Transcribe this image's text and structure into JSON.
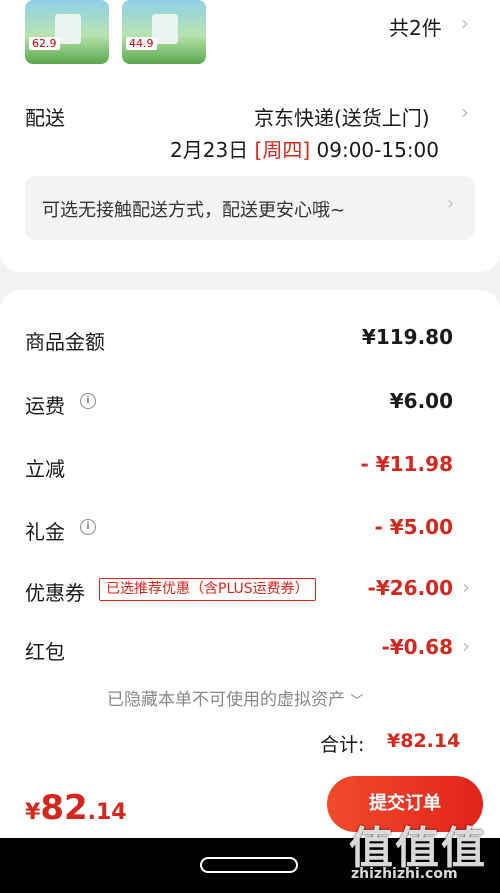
{
  "order": {
    "items_count_label": "共2件",
    "product_thumbs": [
      {
        "price": "62.9"
      },
      {
        "price": "44.9"
      }
    ]
  },
  "delivery": {
    "label": "配送",
    "method": "京东快递(送货上门)",
    "date": "2月23日",
    "weekday": "[周四]",
    "time": "09:00-15:00",
    "notice": "可选无接触配送方式，配送更安心哦~"
  },
  "summary": {
    "goods_amount": {
      "label": "商品金额",
      "value": "¥119.80"
    },
    "shipping": {
      "label": "运费",
      "value": "¥6.00"
    },
    "instant_discount": {
      "label": "立减",
      "value": "- ¥11.98"
    },
    "gift_card": {
      "label": "礼金",
      "value": "- ¥5.00"
    },
    "coupon": {
      "label": "优惠券",
      "tag": "已选推荐优惠（含PLUS运费券）",
      "value": "-¥26.00"
    },
    "red_packet": {
      "label": "红包",
      "value": "-¥0.68"
    },
    "hidden_assets": "已隐藏本单不可使用的虚拟资产",
    "total_label": "合计:",
    "total_value": "¥82.14"
  },
  "bottom": {
    "pay_currency": "¥",
    "pay_integer": "82",
    "pay_decimal": ".14",
    "submit_label": "提交订单"
  },
  "watermark": {
    "big": "值值值",
    "small": "zhizhizhi.com"
  },
  "colors": {
    "accent": "#e2231a",
    "background": "#f2f2f2"
  }
}
